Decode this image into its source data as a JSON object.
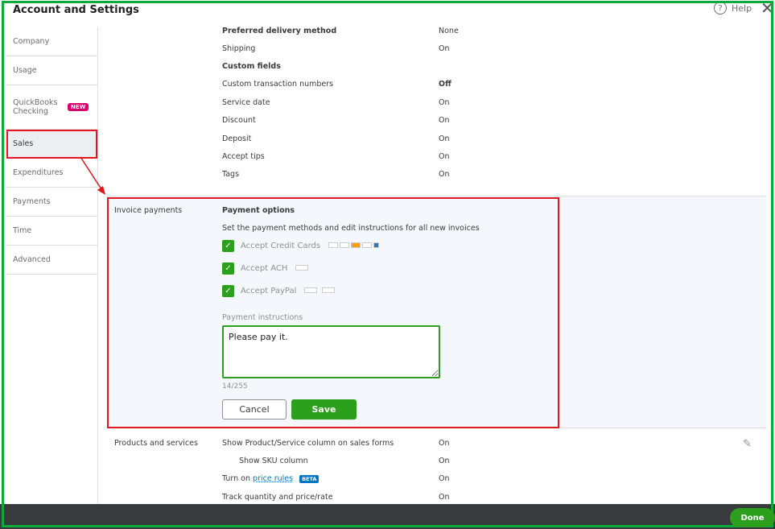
{
  "header": {
    "title": "Account and Settings",
    "help": "Help",
    "close": "✕"
  },
  "sidebar": {
    "items": [
      {
        "label": "Company"
      },
      {
        "label": "Usage"
      },
      {
        "label": "QuickBooks Checking",
        "badge": "NEW"
      },
      {
        "label": "Sales"
      },
      {
        "label": "Expenditures"
      },
      {
        "label": "Payments"
      },
      {
        "label": "Time"
      },
      {
        "label": "Advanced"
      }
    ]
  },
  "top_rows": [
    {
      "name": "Preferred delivery method",
      "value": "None"
    },
    {
      "name": "Shipping",
      "value": "On"
    },
    {
      "name": "Custom fields",
      "value": ""
    },
    {
      "name": "Custom transaction numbers",
      "value": "Off"
    },
    {
      "name": "Service date",
      "value": "On"
    },
    {
      "name": "Discount",
      "value": "On"
    },
    {
      "name": "Deposit",
      "value": "On"
    },
    {
      "name": "Accept tips",
      "value": "On"
    },
    {
      "name": "Tags",
      "value": "On"
    }
  ],
  "invoice_payments": {
    "label": "Invoice payments",
    "heading": "Payment options",
    "description": "Set the payment methods and edit instructions for all new invoices",
    "options": [
      {
        "label": "Accept Credit Cards",
        "checked": true
      },
      {
        "label": "Accept ACH",
        "checked": true
      },
      {
        "label": "Accept PayPal",
        "checked": true
      }
    ],
    "instructions_label": "Payment instructions",
    "instructions_value": "Please pay it.",
    "char_count": "14/255",
    "cancel": "Cancel",
    "save": "Save"
  },
  "products": {
    "label": "Products and services",
    "rows": [
      {
        "name": "Show Product/Service column on sales forms",
        "value": "On"
      },
      {
        "name": "Show SKU column",
        "value": "On"
      },
      {
        "prefix": "Turn on",
        "link": "price rules",
        "badge": "BETA",
        "value": "On"
      },
      {
        "name": "Track quantity and price/rate",
        "value": "On"
      }
    ]
  },
  "footer": {
    "done": "Done"
  }
}
